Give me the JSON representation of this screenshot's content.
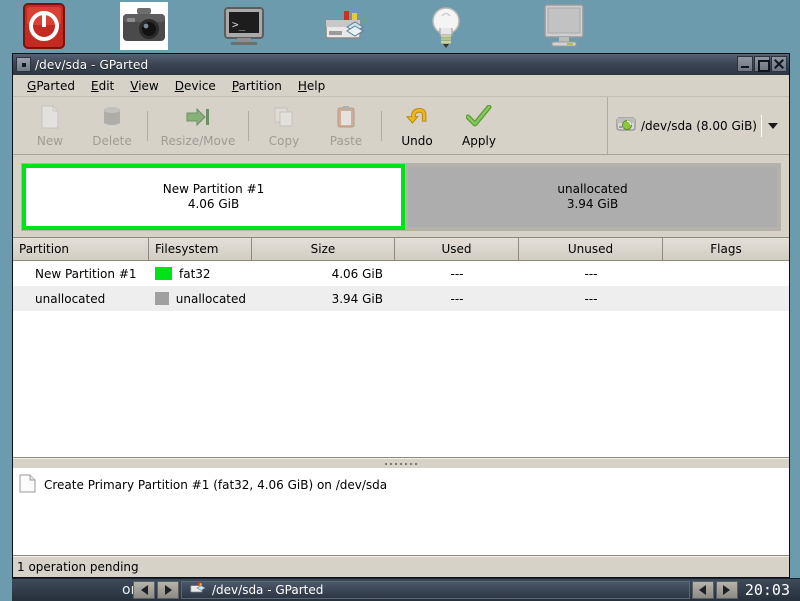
{
  "desktop": {
    "icons": [
      {
        "name": "shutdown-icon",
        "label": ""
      },
      {
        "name": "screenshot-camera-icon",
        "label": ""
      },
      {
        "name": "terminal-icon",
        "label": ""
      },
      {
        "name": "gparted-disk-icon",
        "label": ""
      },
      {
        "name": "lightbulb-help-icon",
        "label": ""
      },
      {
        "name": "monitor-display-icon",
        "label": ""
      }
    ]
  },
  "window": {
    "title": "/dev/sda - GParted",
    "buttons": {
      "minimize": "minimize-icon",
      "maximize": "maximize-icon",
      "close": "close-icon"
    }
  },
  "menubar": {
    "items": [
      {
        "label": "GParted",
        "mnemonic": "G"
      },
      {
        "label": "Edit",
        "mnemonic": "E"
      },
      {
        "label": "View",
        "mnemonic": "V"
      },
      {
        "label": "Device",
        "mnemonic": "D"
      },
      {
        "label": "Partition",
        "mnemonic": "P"
      },
      {
        "label": "Help",
        "mnemonic": "H"
      }
    ]
  },
  "toolbar": {
    "buttons": [
      {
        "label": "New",
        "icon": "new-document-icon",
        "enabled": false
      },
      {
        "label": "Delete",
        "icon": "delete-trash-icon",
        "enabled": false
      },
      {
        "label": "Resize/Move",
        "icon": "resize-move-arrows-icon",
        "enabled": false
      },
      {
        "label": "Copy",
        "icon": "copy-pages-icon",
        "enabled": false
      },
      {
        "label": "Paste",
        "icon": "paste-clipboard-icon",
        "enabled": false
      },
      {
        "label": "Undo",
        "icon": "undo-arrow-icon",
        "enabled": true
      },
      {
        "label": "Apply",
        "icon": "apply-checkmark-icon",
        "enabled": true
      }
    ],
    "device_selector": {
      "icon": "harddisk-icon",
      "value": "/dev/sda  (8.00 GiB)",
      "arrow": "chevron-down-icon"
    }
  },
  "graphic": {
    "partitions": [
      {
        "name": "New Partition #1",
        "size": "4.06 GiB",
        "fill": "#ffffff",
        "border": "#00e218",
        "selected": true,
        "width_pct": 50.4
      },
      {
        "name": "unallocated",
        "size": "3.94 GiB",
        "fill": "#adadad",
        "border": "#b5b2aa",
        "selected": false,
        "width_pct": 49.6
      }
    ]
  },
  "table": {
    "headers": [
      "Partition",
      "Filesystem",
      "Size",
      "Used",
      "Unused",
      "Flags"
    ],
    "rows": [
      {
        "partition": "New Partition #1",
        "filesystem": "fat32",
        "fs_color": "#00e218",
        "size": "4.06 GiB",
        "used": "---",
        "unused": "---",
        "flags": ""
      },
      {
        "partition": "unallocated",
        "filesystem": "unallocated",
        "fs_color": "#a0a0a0",
        "size": "3.94 GiB",
        "used": "---",
        "unused": "---",
        "flags": ""
      }
    ]
  },
  "operations": {
    "items": [
      {
        "icon": "operation-document-icon",
        "text": "Create Primary Partition #1 (fat32, 4.06 GiB) on /dev/sda"
      }
    ]
  },
  "statusbar": {
    "text": "1 operation pending"
  },
  "taskbar": {
    "desktop_label": "one",
    "prev_icon": "arrow-left-icon",
    "next_icon": "arrow-right-icon",
    "task": {
      "icon": "gparted-disk-icon",
      "label": "/dev/sda - GParted"
    },
    "pager_prev_icon": "arrow-left-icon",
    "pager_next_icon": "arrow-right-icon",
    "clock": "20:03"
  },
  "colors": {
    "desktop_bg": "#6d9bae",
    "window_bg": "#d6d2c8",
    "selection_green": "#00e218",
    "unallocated_gray": "#adadad"
  }
}
